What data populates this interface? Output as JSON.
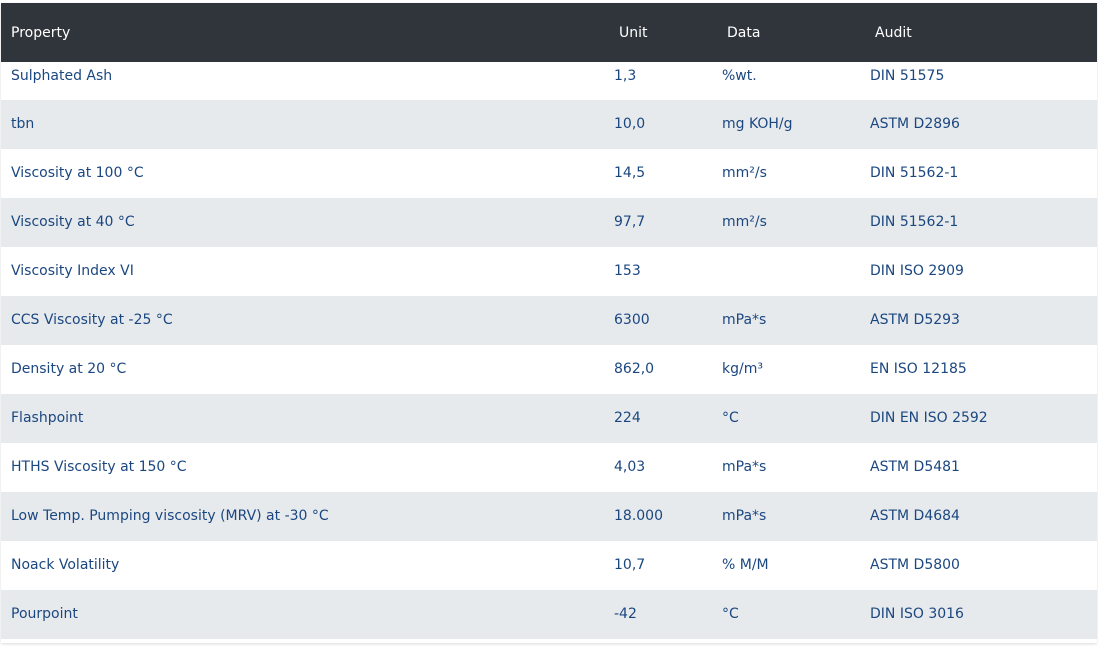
{
  "header": {
    "col1": "Property",
    "col2": "Unit",
    "col3": "Data",
    "col4": "Audit"
  },
  "rows": [
    {
      "property": "Sulphated Ash",
      "value": "1,3",
      "unit": "%wt.",
      "audit": "DIN 51575"
    },
    {
      "property": "tbn",
      "value": "10,0",
      "unit": "mg KOH/g",
      "audit": "ASTM D2896"
    },
    {
      "property": "Viscosity at 100 °C",
      "value": "14,5",
      "unit": "mm²/s",
      "audit": "DIN 51562-1"
    },
    {
      "property": "Viscosity at 40 °C",
      "value": "97,7",
      "unit": "mm²/s",
      "audit": "DIN 51562-1"
    },
    {
      "property": "Viscosity Index VI",
      "value": "153",
      "unit": "",
      "audit": "DIN ISO 2909"
    },
    {
      "property": "CCS Viscosity at -25 °C",
      "value": "6300",
      "unit": "mPa*s",
      "audit": "ASTM D5293"
    },
    {
      "property": "Density at 20 °C",
      "value": "862,0",
      "unit": "kg/m³",
      "audit": "EN ISO 12185"
    },
    {
      "property": "Flashpoint",
      "value": "224",
      "unit": "°C",
      "audit": "DIN EN ISO 2592"
    },
    {
      "property": "HTHS Viscosity at 150 °C",
      "value": "4,03",
      "unit": "mPa*s",
      "audit": "ASTM D5481"
    },
    {
      "property": "Low Temp. Pumping viscosity (MRV) at -30 °C",
      "value": "18.000",
      "unit": "mPa*s",
      "audit": "ASTM D4684"
    },
    {
      "property": "Noack Volatility",
      "value": "10,7",
      "unit": "% M/M",
      "audit": "ASTM D5800"
    },
    {
      "property": "Pourpoint",
      "value": "-42",
      "unit": "°C",
      "audit": "DIN ISO 3016"
    }
  ],
  "colors": {
    "header_bg": "#30353c",
    "header_text": "#ffffff",
    "cell_text": "#1b4780",
    "row_alt_bg": "#e7eaed",
    "row_bg": "#ffffff"
  }
}
